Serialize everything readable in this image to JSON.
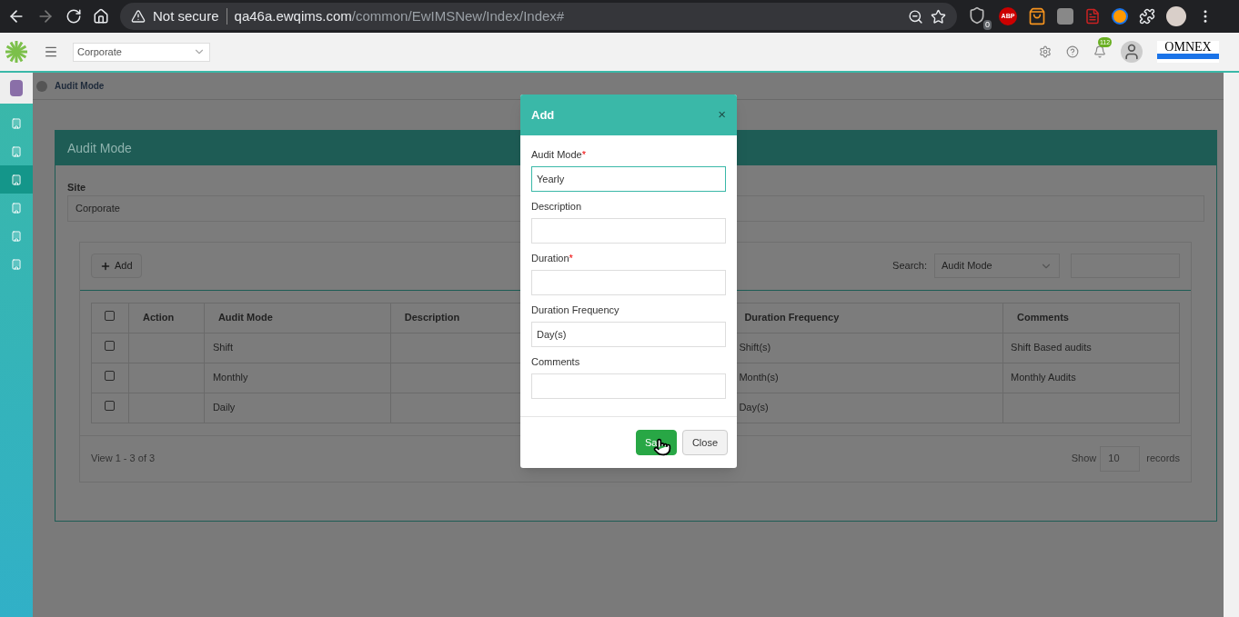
{
  "browser": {
    "security": "Not secure",
    "url_host": "qa46a.ewqims.com",
    "url_path": "/common/EwIMSNew/Index/Index#",
    "extension_badge": "0",
    "adblock_label": "ABP"
  },
  "header": {
    "site_select": "Corporate",
    "notification_count": "112",
    "logo_text": "OMNEX"
  },
  "sidebar": {
    "items": [
      {
        "selected": false
      },
      {
        "selected": false
      },
      {
        "selected": true
      },
      {
        "selected": false
      },
      {
        "selected": false
      },
      {
        "selected": false
      }
    ]
  },
  "breadcrumb": "Audit Mode",
  "panel": {
    "title": "Audit Mode",
    "site_label": "Site",
    "site_value": "Corporate",
    "add_button": "Add",
    "search_label": "Search:",
    "search_field": "Audit Mode",
    "header_checked": false,
    "columns": [
      "Action",
      "Audit Mode",
      "Description",
      "Duration Frequency",
      "Comments"
    ],
    "rows": [
      {
        "checked": false,
        "audit_mode": "Shift",
        "duration_frequency": "Shift(s)",
        "comments": "Shift Based audits"
      },
      {
        "checked": false,
        "audit_mode": "Monthly",
        "duration_frequency": "Month(s)",
        "comments": "Monthly Audits"
      },
      {
        "checked": false,
        "audit_mode": "Daily",
        "duration_frequency": "Day(s)"
      }
    ],
    "pager": "View 1 - 3 of 3",
    "show_label": "Show",
    "page_size": "10",
    "records_label": "records"
  },
  "dialog": {
    "title": "Add",
    "close": "×",
    "fields": [
      {
        "label": "Audit Mode",
        "required_mark": "*",
        "value": "Yearly",
        "focused": true
      },
      {
        "label": "Description",
        "focused": false
      },
      {
        "label": "Duration",
        "required_mark": "*",
        "focused": false
      },
      {
        "label": "Duration Frequency",
        "value": "Day(s)",
        "focused": false
      },
      {
        "label": "Comments",
        "focused": false
      }
    ],
    "buttons": [
      {
        "label": "Sa",
        "kind": "primary"
      },
      {
        "label": "Close",
        "kind": "secondary"
      }
    ]
  }
}
